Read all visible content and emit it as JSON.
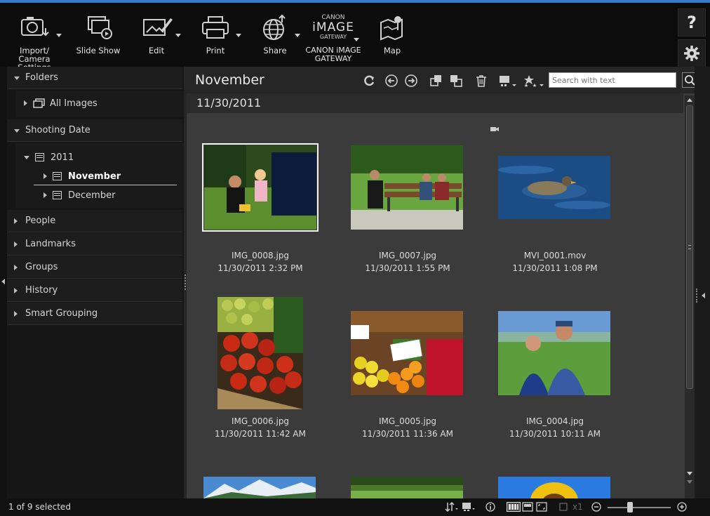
{
  "toolbar": {
    "import_label": "Import/\nCamera Settings",
    "slideshow_label": "Slide Show",
    "edit_label": "Edit",
    "print_label": "Print",
    "share_label": "Share",
    "gateway_logo_top": "CANON",
    "gateway_logo_mid": "iMAGE",
    "gateway_logo_bot": "GATEWAY",
    "gateway_label": "CANON iMAGE\nGATEWAY",
    "map_label": "Map",
    "help_label": "?"
  },
  "sidebar": {
    "folders_label": "Folders",
    "all_images_label": "All Images",
    "shooting_date_label": "Shooting Date",
    "year_label": "2011",
    "november_label": "November",
    "december_label": "December",
    "people_label": "People",
    "landmarks_label": "Landmarks",
    "groups_label": "Groups",
    "history_label": "History",
    "smart_grouping_label": "Smart Grouping"
  },
  "content": {
    "title": "November",
    "date_header": "11/30/2011",
    "search_placeholder": "Search with text"
  },
  "thumbnails": [
    {
      "name": "IMG_0008.jpg",
      "date": "11/30/2011 2:32 PM"
    },
    {
      "name": "IMG_0007.jpg",
      "date": "11/30/2011 1:55 PM"
    },
    {
      "name": "MVI_0001.mov",
      "date": "11/30/2011 1:08 PM"
    },
    {
      "name": "IMG_0006.jpg",
      "date": "11/30/2011 11:42 AM"
    },
    {
      "name": "IMG_0005.jpg",
      "date": "11/30/2011 11:36 AM"
    },
    {
      "name": "IMG_0004.jpg",
      "date": "11/30/2011 10:11 AM"
    }
  ],
  "status": {
    "selection": "1 of 9 selected",
    "zoom": "x1"
  },
  "colors": {
    "accent": "#3a79c4",
    "background": "#3b3b3b",
    "panel": "#1d1d1d"
  }
}
